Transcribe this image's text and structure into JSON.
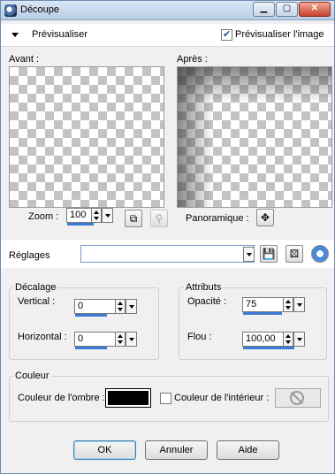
{
  "window": {
    "title": "Découpe",
    "minimize": "▁",
    "maximize": "▢",
    "close": "✕"
  },
  "preview_bar": {
    "label": "Prévisualiser",
    "checkbox_label": "Prévisualiser l'image",
    "checked": true
  },
  "before": {
    "label": "Avant :"
  },
  "after": {
    "label": "Après :"
  },
  "zoom": {
    "label": "Zoom :",
    "value": "100",
    "fit_icon": "fit-window-icon",
    "zoom_icon": "zoom-magnifier-icon"
  },
  "pan": {
    "label": "Panoramique :",
    "icon": "move-crosshair-icon"
  },
  "presets": {
    "label": "Réglages",
    "value": "",
    "save_icon": "save-disk-icon",
    "random_icon": "dice-icon",
    "reset_icon": "reset-arrow-icon"
  },
  "offset": {
    "title": "Décalage",
    "vertical_label": "Vertical :",
    "vertical_value": "0",
    "horizontal_label": "Horizontal :",
    "horizontal_value": "0"
  },
  "attributes": {
    "title": "Attributs",
    "opacity_label": "Opacité :",
    "opacity_value": "75",
    "blur_label": "Flou :",
    "blur_value": "100,00"
  },
  "color": {
    "title": "Couleur",
    "shadow_label": "Couleur de l'ombre :",
    "shadow_color": "#000000",
    "inner_checkbox_label": "Couleur de l'intérieur :",
    "inner_checked": false
  },
  "buttons": {
    "ok": "OK",
    "cancel": "Annuler",
    "help": "Aide"
  },
  "colors": {
    "accent": "#3b7bd6",
    "title_bar": "#c8d8ec",
    "close": "#c7402c"
  }
}
